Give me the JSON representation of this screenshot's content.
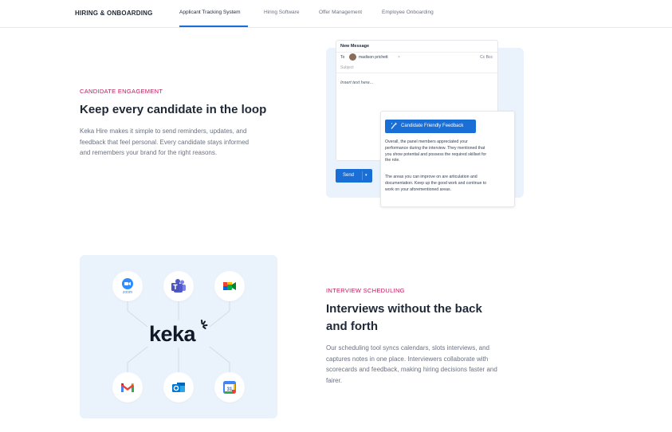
{
  "nav": {
    "brand": "HIRING & ONBOARDING",
    "tabs": [
      {
        "label": "Applicant Tracking System",
        "active": true
      },
      {
        "label": "Hiring Software",
        "active": false
      },
      {
        "label": "Offer Management",
        "active": false
      },
      {
        "label": "Employee Onboarding",
        "active": false
      }
    ]
  },
  "engagement": {
    "eyebrow": "CANDIDATE ENGAGEMENT",
    "heading": "Keep every candidate in the loop",
    "body_lines": [
      "Keka Hire makes it simple to send reminders, updates, and",
      "feedback that feel personal. Every candidate stays informed",
      "and remembers your brand for the right reasons."
    ]
  },
  "email": {
    "title": "New Message",
    "to_label": "To",
    "recipient": "madison prichett",
    "remove_glyph": "×",
    "cc_bcc": "Cc Bcc",
    "subject_placeholder": "Subject",
    "body_placeholder": "Insert text here...",
    "send_label": "Send",
    "send_caret": "▾"
  },
  "feedback": {
    "button_label": "Candidate Friendly Feedback",
    "para1_lines": [
      "Overall,  the panel members appreciated your",
      "performance during the interview. They mentioned that",
      "you show potential and possess the required skillset for",
      "the role."
    ],
    "para2_lines": [
      "The areas you can improve on are articulation and",
      "documentation. Keep up the good work and continue to",
      "work on your aforementioned areas."
    ]
  },
  "scheduling": {
    "eyebrow": "INTERVIEW SCHEDULING",
    "heading_lines": [
      "Interviews without the back",
      "and forth"
    ],
    "body_lines": [
      "Our scheduling tool syncs calendars, slots interviews, and",
      "captures notes in one place. Interviewers collaborate with",
      "scorecards and feedback, making hiring decisions faster and",
      "fairer."
    ]
  },
  "integrations": {
    "logo": "keka",
    "zoom_label": "zoom",
    "calendar_day": "31",
    "items": [
      {
        "name": "zoom",
        "icon": "zoom-icon"
      },
      {
        "name": "teams",
        "icon": "teams-icon"
      },
      {
        "name": "meet",
        "icon": "google-meet-icon"
      },
      {
        "name": "gmail",
        "icon": "gmail-icon"
      },
      {
        "name": "outlook",
        "icon": "outlook-icon"
      },
      {
        "name": "calendar",
        "icon": "google-calendar-icon"
      }
    ]
  },
  "colors": {
    "accent": "#1a6fd6",
    "eyebrow": "#c2185b",
    "panel_bg": "#eaf3fc"
  }
}
